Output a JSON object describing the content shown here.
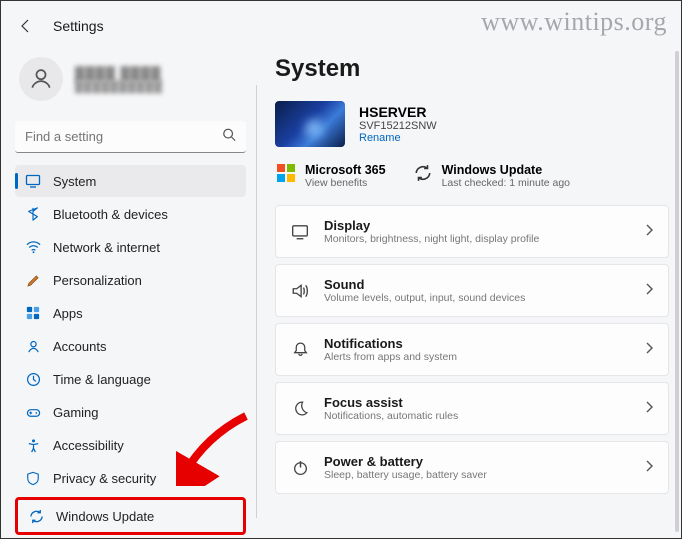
{
  "watermark": "www.wintips.org",
  "header": {
    "title": "Settings"
  },
  "profile": {
    "name": "████ ████",
    "email": "██████████"
  },
  "search": {
    "placeholder": "Find a setting"
  },
  "sidebar": {
    "items": [
      {
        "label": "System"
      },
      {
        "label": "Bluetooth & devices"
      },
      {
        "label": "Network & internet"
      },
      {
        "label": "Personalization"
      },
      {
        "label": "Apps"
      },
      {
        "label": "Accounts"
      },
      {
        "label": "Time & language"
      },
      {
        "label": "Gaming"
      },
      {
        "label": "Accessibility"
      },
      {
        "label": "Privacy & security"
      },
      {
        "label": "Windows Update"
      }
    ]
  },
  "main": {
    "title": "System",
    "device": {
      "name": "HSERVER",
      "model": "SVF15212SNW",
      "rename": "Rename"
    },
    "status": {
      "ms365": {
        "label": "Microsoft 365",
        "sub": "View benefits"
      },
      "wu": {
        "label": "Windows Update",
        "sub": "Last checked: 1 minute ago"
      }
    },
    "cards": [
      {
        "title": "Display",
        "sub": "Monitors, brightness, night light, display profile"
      },
      {
        "title": "Sound",
        "sub": "Volume levels, output, input, sound devices"
      },
      {
        "title": "Notifications",
        "sub": "Alerts from apps and system"
      },
      {
        "title": "Focus assist",
        "sub": "Notifications, automatic rules"
      },
      {
        "title": "Power & battery",
        "sub": "Sleep, battery usage, battery saver"
      }
    ]
  }
}
